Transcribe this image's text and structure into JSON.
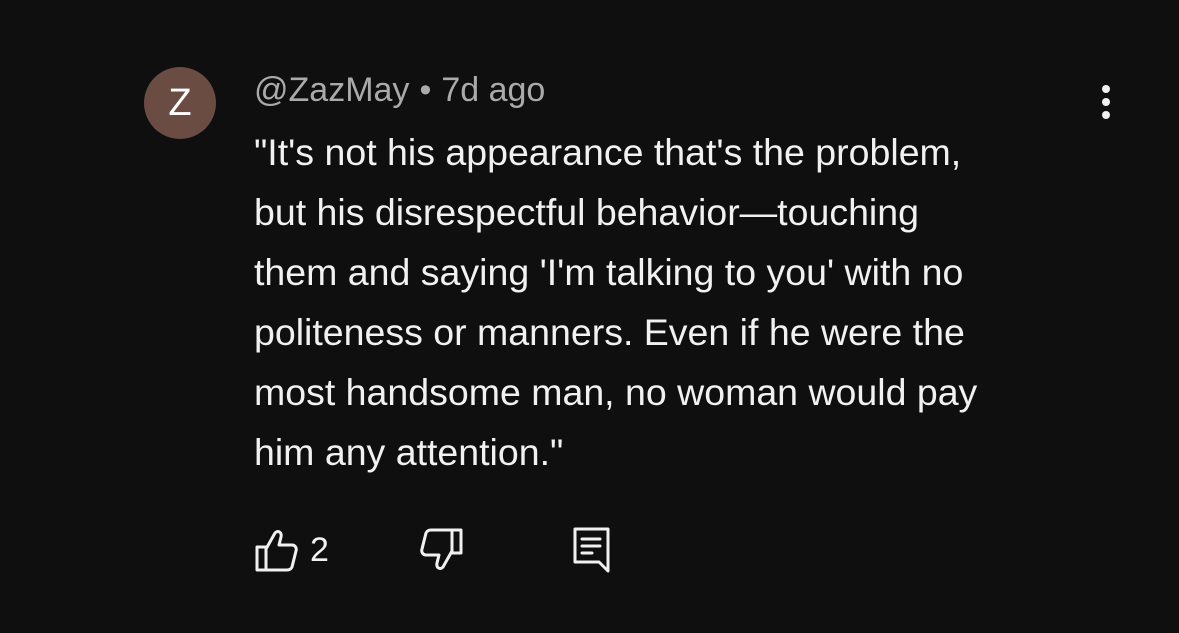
{
  "colors": {
    "background": "#0f0f0f",
    "avatar_bg": "#6b4c43",
    "text_primary": "#f1f1f1",
    "text_secondary": "#aaaaaa"
  },
  "comment": {
    "avatar_initial": "Z",
    "author": "@ZazMay",
    "separator": "•",
    "timestamp": "7d ago",
    "text": "\"It's not his appearance that's the problem,\nbut his disrespectful behavior—touching\nthem and saying 'I'm talking to you' with no\npoliteness or manners. Even if he were the\nmost handsome man, no woman would pay\nhim any attention.\"",
    "menu_icon": "more-vertical-icon"
  },
  "actions": {
    "like_icon": "thumbs-up-icon",
    "like_count": "2",
    "dislike_icon": "thumbs-down-icon",
    "reply_icon": "reply-comment-icon"
  }
}
